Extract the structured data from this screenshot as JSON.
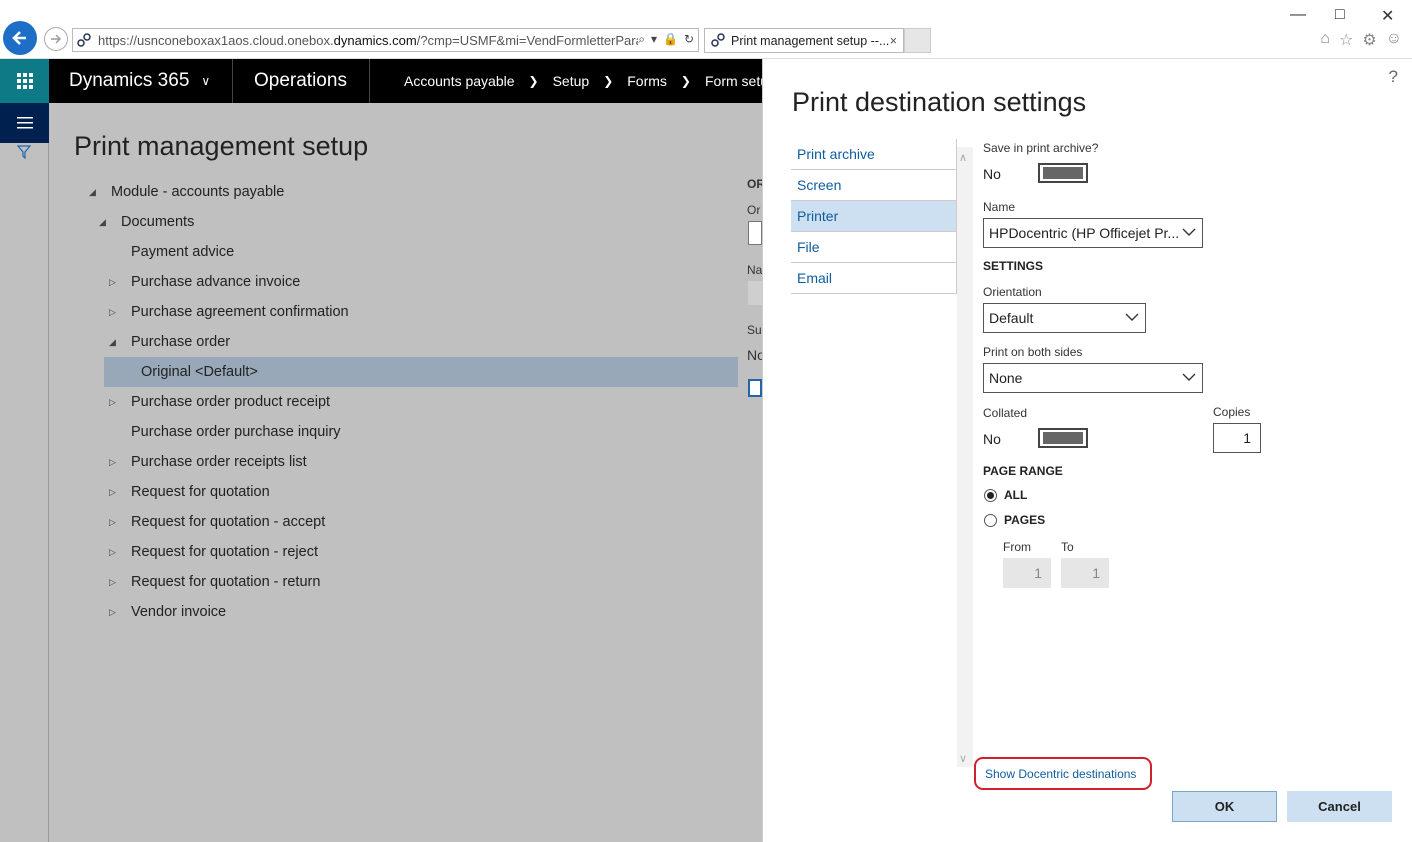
{
  "browser": {
    "url_prefix": "https://usnconeboxax1aos.cloud.onebox.",
    "url_domain": "dynamics.com",
    "url_rest": "/?cmp=USMF&mi=VendFormletterParamete",
    "tab_title": "Print management setup --...",
    "tab_close": "×"
  },
  "appbar": {
    "brand": "Dynamics 365",
    "module": "Operations",
    "breadcrumbs": [
      "Accounts payable",
      "Setup",
      "Forms",
      "Form setup"
    ]
  },
  "page": {
    "title": "Print management setup",
    "tree": [
      {
        "label": "Module - accounts payable",
        "expander": "expanded"
      },
      {
        "label": "Documents",
        "expander": "expanded"
      },
      {
        "label": "Payment advice",
        "expander": "none"
      },
      {
        "label": "Purchase advance invoice",
        "expander": "collapsed"
      },
      {
        "label": "Purchase agreement confirmation",
        "expander": "collapsed"
      },
      {
        "label": "Purchase order",
        "expander": "expanded"
      },
      {
        "label": "Original <Default>",
        "expander": "none"
      },
      {
        "label": "Purchase order product receipt",
        "expander": "collapsed"
      },
      {
        "label": "Purchase order purchase inquiry",
        "expander": "none"
      },
      {
        "label": "Purchase order receipts list",
        "expander": "collapsed"
      },
      {
        "label": "Request for quotation",
        "expander": "collapsed"
      },
      {
        "label": "Request for quotation - accept",
        "expander": "collapsed"
      },
      {
        "label": "Request for quotation - reject",
        "expander": "collapsed"
      },
      {
        "label": "Request for quotation - return",
        "expander": "collapsed"
      },
      {
        "label": "Vendor invoice",
        "expander": "collapsed"
      }
    ],
    "right_fragments": {
      "or_header": "OR",
      "or": "Or",
      "na": "Na",
      "su": "Su",
      "no": "No"
    }
  },
  "dialog": {
    "help": "?",
    "title": "Print destination settings",
    "nav": [
      "Print archive",
      "Screen",
      "Printer",
      "File",
      "Email"
    ],
    "active_nav": "Printer",
    "save_archive_label": "Save in print archive?",
    "save_archive_value": "No",
    "name_label": "Name",
    "name_value": "HPDocentric (HP Officejet Pr...",
    "settings_header": "SETTINGS",
    "orientation_label": "Orientation",
    "orientation_value": "Default",
    "both_sides_label": "Print on both sides",
    "both_sides_value": "None",
    "collated_label": "Collated",
    "collated_value": "No",
    "copies_label": "Copies",
    "copies_value": "1",
    "page_range_header": "PAGE RANGE",
    "radio_all": "ALL",
    "radio_pages": "PAGES",
    "from_label": "From",
    "to_label": "To",
    "from_value": "1",
    "to_value": "1",
    "docentric_link": "Show Docentric destinations",
    "ok": "OK",
    "cancel": "Cancel"
  },
  "colors": {
    "accent": "#0e7a86",
    "nav_dark": "#002050",
    "link": "#0e5c9e",
    "highlight": "#d0202a"
  }
}
